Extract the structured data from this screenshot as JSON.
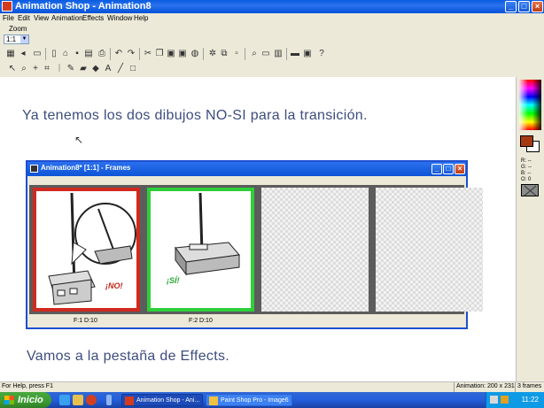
{
  "window": {
    "title": "Animation Shop - Animation8"
  },
  "menu": [
    "File",
    "Edit",
    "View",
    "Animation",
    "Effects",
    "Window",
    "Help"
  ],
  "zoom": {
    "label": "Zoom",
    "value": "1:1"
  },
  "tutorial": {
    "line1": "Ya tenemos los dos dibujos NO-SI para la transición.",
    "line2": "Vamos a la pestaña de Effects."
  },
  "frames_window": {
    "title": "Animation8* [1:1] - Frames",
    "frames": [
      {
        "label": "F:1  D:10",
        "stamp": "¡NO!",
        "border_color": "#d02a20"
      },
      {
        "label": "F:2  D:10",
        "stamp": "¡SÍ!",
        "border_color": "#2ecf3a"
      },
      {
        "label": "",
        "stamp": ""
      },
      {
        "label": "",
        "stamp": ""
      }
    ]
  },
  "palette": {
    "foreground_color": "#a53a12",
    "background_color": "#ffffff",
    "values": [
      "R: --",
      "G: --",
      "B: --",
      "O: 0"
    ]
  },
  "status": {
    "help": "For Help, press F1",
    "animation": "Animation: 200 x 231",
    "frames": "3 frames"
  },
  "taskbar": {
    "start_label": "Inicio",
    "tasks": [
      "Animation Shop - Ani...",
      "Paint Shop Pro - Image6"
    ],
    "clock": "11:22"
  }
}
